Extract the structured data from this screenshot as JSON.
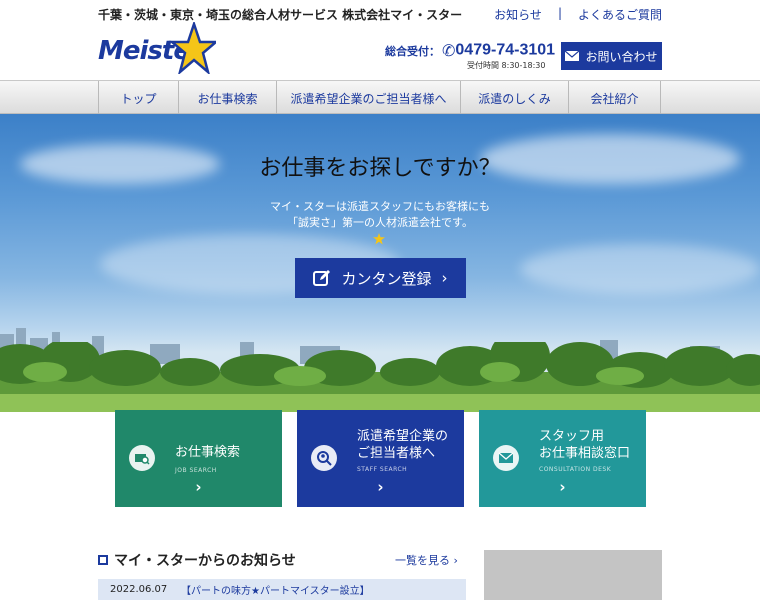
{
  "header": {
    "tagline": "千葉・茨城・東京・埼玉の総合人材サービス 株式会社マイ・スター",
    "links": [
      "お知らせ",
      "よくあるご質問"
    ],
    "link_separator": "|",
    "logo_text": "Meister",
    "contact_label": "総合受付：",
    "phone": "0479-74-3101",
    "hours": "受付時間 8:30-18:30",
    "inquiry_button": "お問い合わせ"
  },
  "nav": {
    "items": [
      "トップ",
      "お仕事検索",
      "派遣希望企業のご担当者様へ",
      "派遣のしくみ",
      "会社紹介"
    ]
  },
  "hero": {
    "title": "お仕事をお探しですか？",
    "sub1": "マイ・スターは派遣スタッフにもお客様にも",
    "sub2": "「誠実さ」第一の人材派遣会社です。",
    "register_button": "カンタン登録",
    "register_arrow": "›"
  },
  "cards": [
    {
      "title_lines": [
        "お仕事検索"
      ],
      "en": "JOB SEARCH",
      "arrow": "›"
    },
    {
      "title_lines": [
        "派遣希望企業の",
        "ご担当者様へ"
      ],
      "en": "STAFF SEARCH",
      "arrow": "›"
    },
    {
      "title_lines": [
        "スタッフ用",
        "お仕事相談窓口"
      ],
      "en": "CONSULTATION DESK",
      "arrow": "›"
    }
  ],
  "news": {
    "title": "マイ・スターからのお知らせ",
    "more": "一覧を見る ›",
    "items": [
      {
        "date": "2022.06.07",
        "text": "【パートの味方★パートマイスター設立】"
      }
    ]
  },
  "colors": {
    "brand_blue": "#1c3a9e",
    "card_green": "#20886a",
    "card_teal": "#22989a"
  }
}
